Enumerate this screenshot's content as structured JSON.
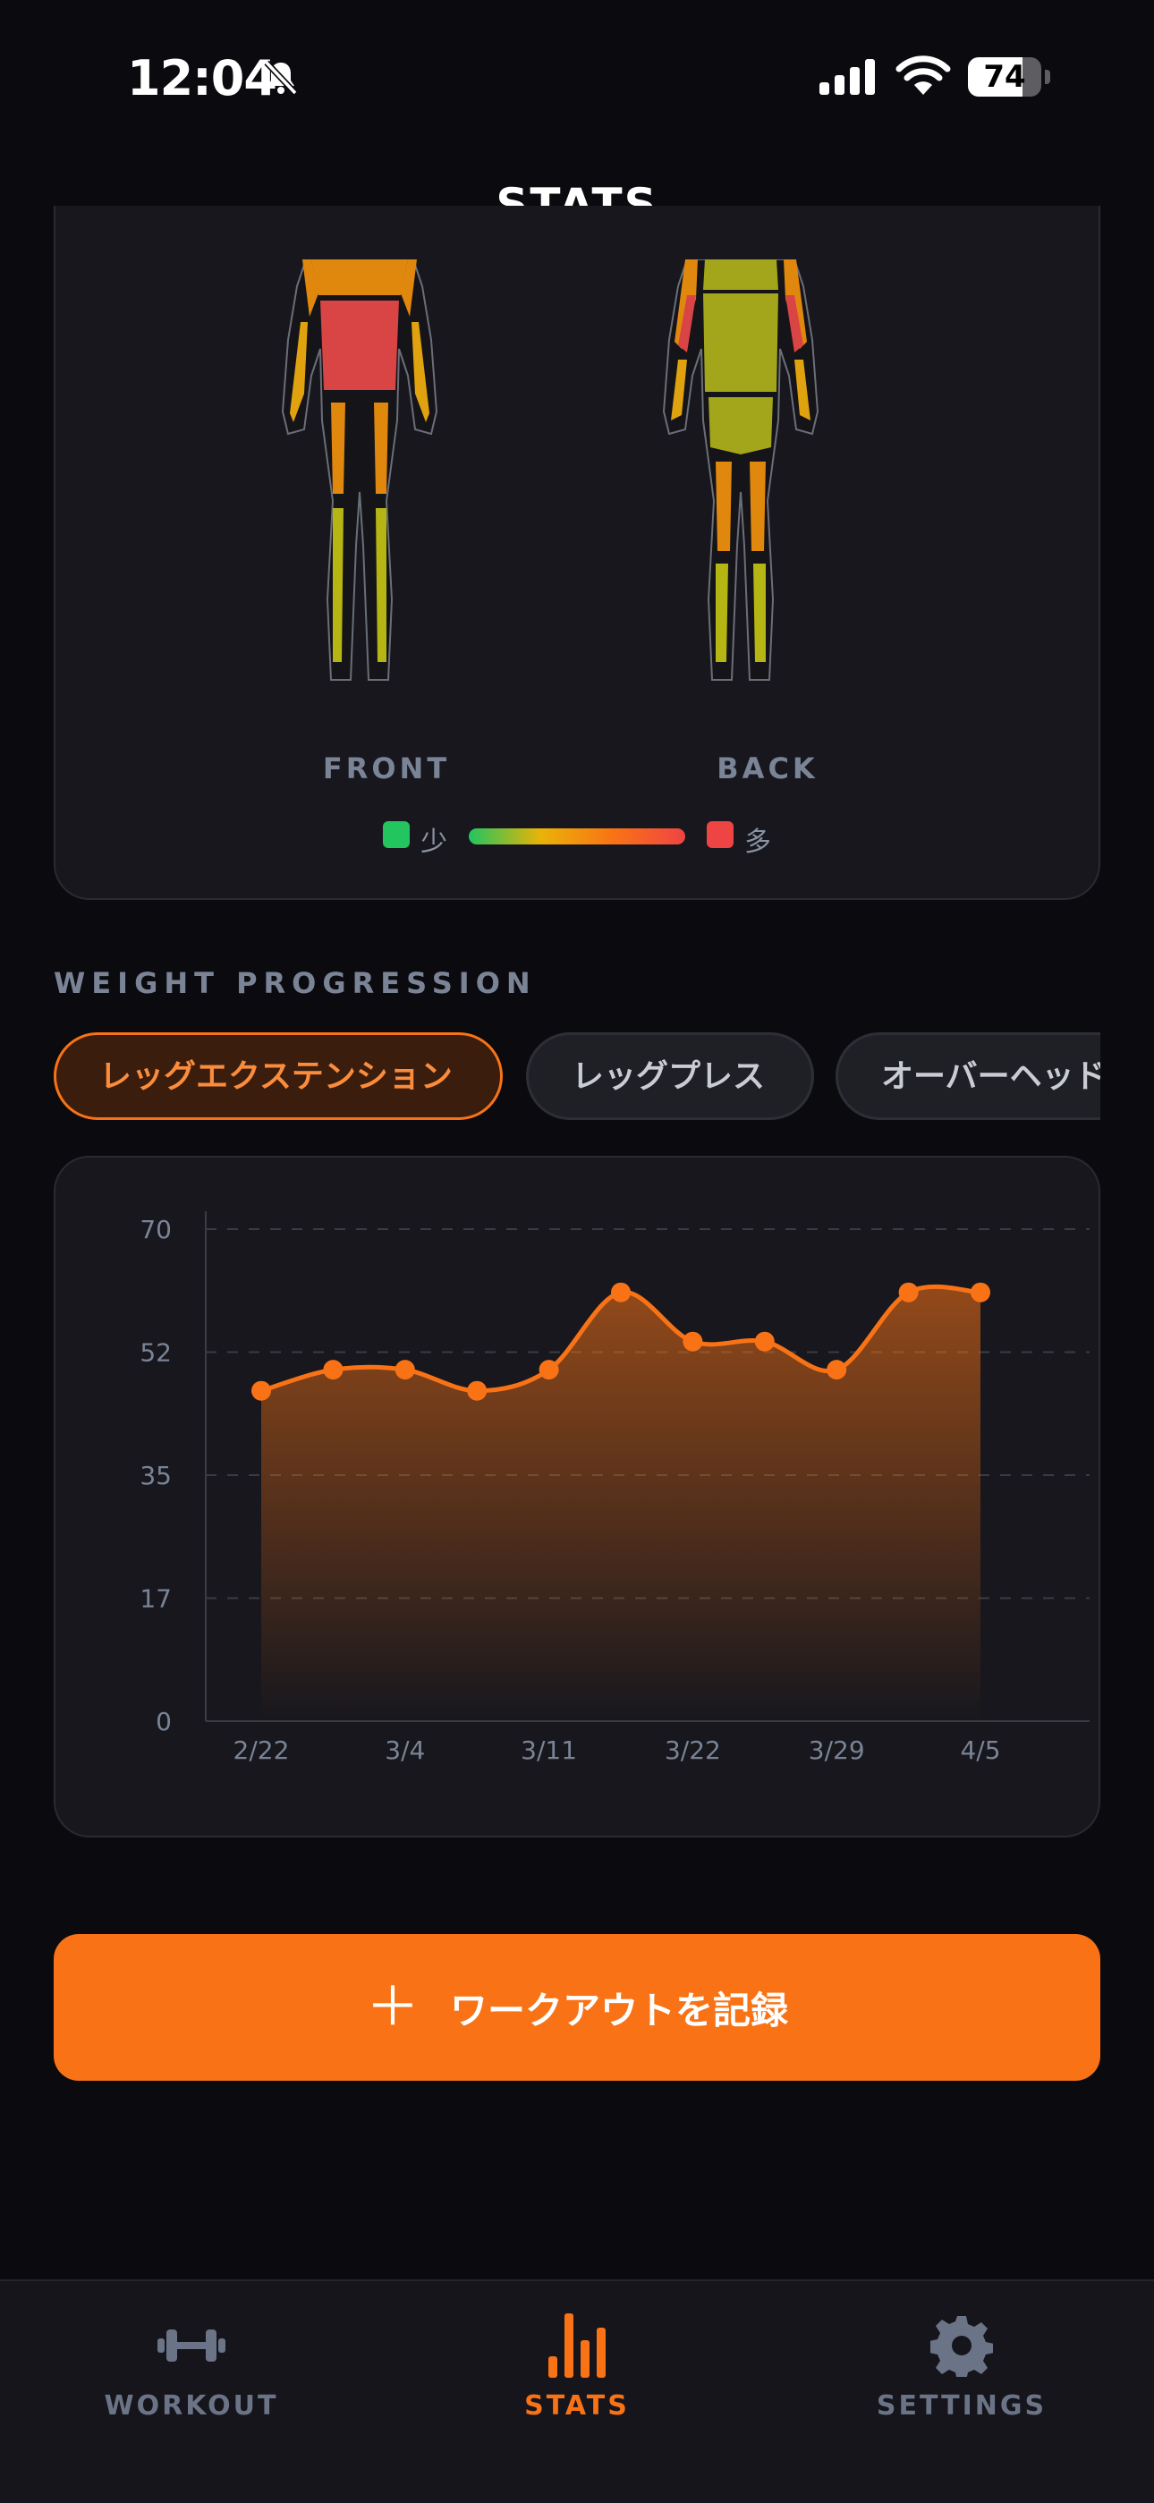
{
  "status_bar": {
    "time": "12:04",
    "battery_level": "74"
  },
  "header": {
    "title": "STATS"
  },
  "muscle_map": {
    "front_label": "FRONT",
    "back_label": "BACK",
    "legend": {
      "low_label": "少",
      "high_label": "多",
      "low_color": "#22c55e",
      "high_color": "#ef4444"
    }
  },
  "weight_progression": {
    "section_title": "WEIGHT PROGRESSION",
    "exercise_chips": [
      {
        "label": "レッグエクステンション",
        "active": true
      },
      {
        "label": "レッグプレス",
        "active": false
      },
      {
        "label": "オーバーヘッドプレス",
        "active": false
      }
    ]
  },
  "chart_data": {
    "type": "area",
    "x_tick_labels": [
      "2/22",
      "3/4",
      "3/11",
      "3/22",
      "3/29",
      "4/5"
    ],
    "y_tick_labels": [
      "70",
      "52",
      "35",
      "17",
      "0"
    ],
    "ylim": [
      0,
      70
    ],
    "grid": true,
    "series": [
      {
        "values": [
          47,
          50,
          50,
          47,
          50,
          61,
          54,
          54,
          50,
          61,
          61
        ],
        "color": "#f97316"
      }
    ]
  },
  "cta": {
    "icon": "plus-icon",
    "label": "ワークアウトを記録"
  },
  "tab_bar": {
    "items": [
      {
        "label": "WORKOUT",
        "icon": "dumbbell-icon",
        "active": false
      },
      {
        "label": "STATS",
        "icon": "bar-chart-icon",
        "active": true
      },
      {
        "label": "SETTINGS",
        "icon": "gear-icon",
        "active": false
      }
    ],
    "active_color": "#f97316",
    "inactive_color": "#6b7486"
  }
}
